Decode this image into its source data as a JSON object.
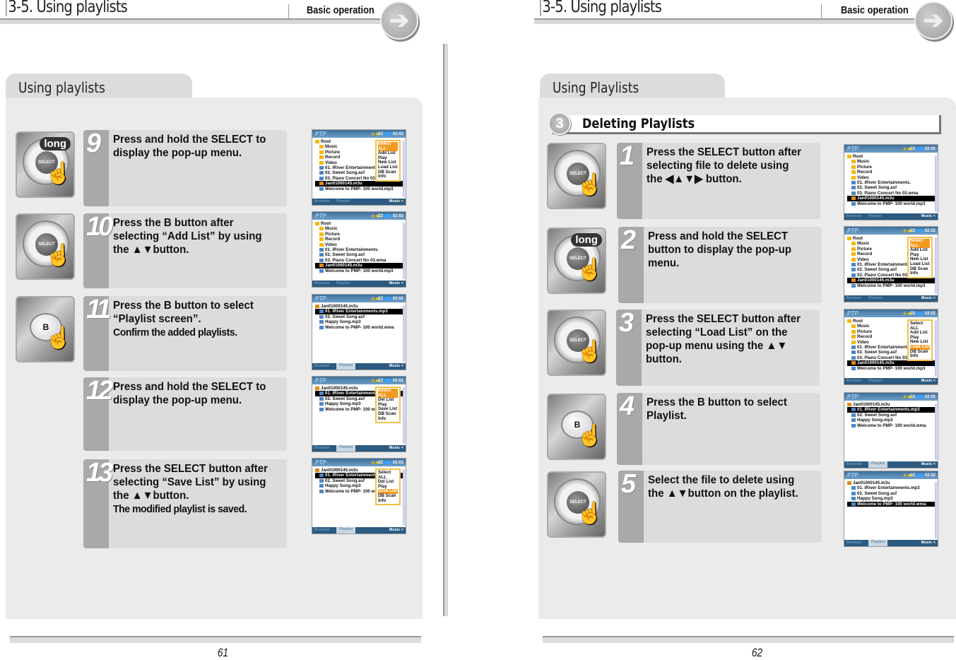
{
  "pages": [
    {
      "header": {
        "title": "3-5. Using playlists",
        "section": "Basic operation",
        "arrow_icon": "right-arrow-icon"
      },
      "tab_title": "Using playlists",
      "page_number": "61",
      "steps": [
        {
          "number": "9",
          "device": "select-long",
          "text": "Press and hold the SELECT to display the pop-up menu.",
          "note": ""
        },
        {
          "number": "10",
          "device": "select",
          "text": "Press the B button after selecting “Add List” by using the ▲▼button.",
          "note": ""
        },
        {
          "number": "11",
          "device": "b",
          "text": "Press the B button to select “Playlist screen”.",
          "note": "Confirm the added playlists."
        },
        {
          "number": "12",
          "device": "none",
          "text": "Press and hold the SELECT to display the pop-up menu.",
          "note": ""
        },
        {
          "number": "13",
          "device": "none",
          "text": "Press the SELECT button after selecting “Save List” by using the ▲▼button.",
          "note": "The modified playlist is saved."
        }
      ]
    },
    {
      "header": {
        "title": "3-5. Using playlists",
        "section": "Basic operation",
        "arrow_icon": "right-arrow-icon"
      },
      "tab_title": "Using Playlists",
      "section_number": "3",
      "section_title": "Deleting Playlists",
      "page_number": "62",
      "steps": [
        {
          "number": "1",
          "device": "select",
          "text": "Press the SELECT button after selecting file to delete using the ◀▲▼▶ button.",
          "note": ""
        },
        {
          "number": "2",
          "device": "select-long",
          "text": "Press and hold the SELECT button to display the pop-up menu.",
          "note": ""
        },
        {
          "number": "3",
          "device": "select",
          "text": "Press the SELECT button after selecting “Load List” on the pop-up menu using the ▲▼ button.",
          "note": ""
        },
        {
          "number": "4",
          "device": "b",
          "text": "Press the B button to select Playlist.",
          "note": ""
        },
        {
          "number": "5",
          "device": "select",
          "text": "Select the file to delete using the ▲▼button on the playlist.",
          "note": ""
        }
      ]
    }
  ],
  "device_labels": {
    "long": "long",
    "select": "SELECT",
    "b": "B"
  },
  "screen_common": {
    "logo": "PTP",
    "volume": "22",
    "time": "02:02",
    "tab_browser": "Browser",
    "tab_playlist": "Playlist",
    "mode": "Music <"
  },
  "screens": {
    "browser_rows": [
      "Root",
      "Music",
      "Picture",
      "Record",
      "Video",
      "01. iRiver Entertainments.",
      "02. Sweet Song.asf",
      "03. Piano Concert No 03.wma",
      "Jan01000145.m3u",
      "Welcome to PMP- 100 world.mp3"
    ],
    "browser_menu": [
      "Select ALL",
      "Add List",
      "Play",
      "New List",
      "Load List",
      "DB Scan",
      "Info"
    ],
    "playlist_rows": [
      "Jan01000145.m3u",
      "01. iRiver Entertainments.mp3",
      "02. Sweet Song.asf",
      "Happy Song.mp3",
      "Welcome to PMP- 100 world.wma"
    ],
    "playlist_menu": [
      "Select ALL",
      "Del List",
      "Play",
      "Save List",
      "DB Scan",
      "Info"
    ]
  }
}
